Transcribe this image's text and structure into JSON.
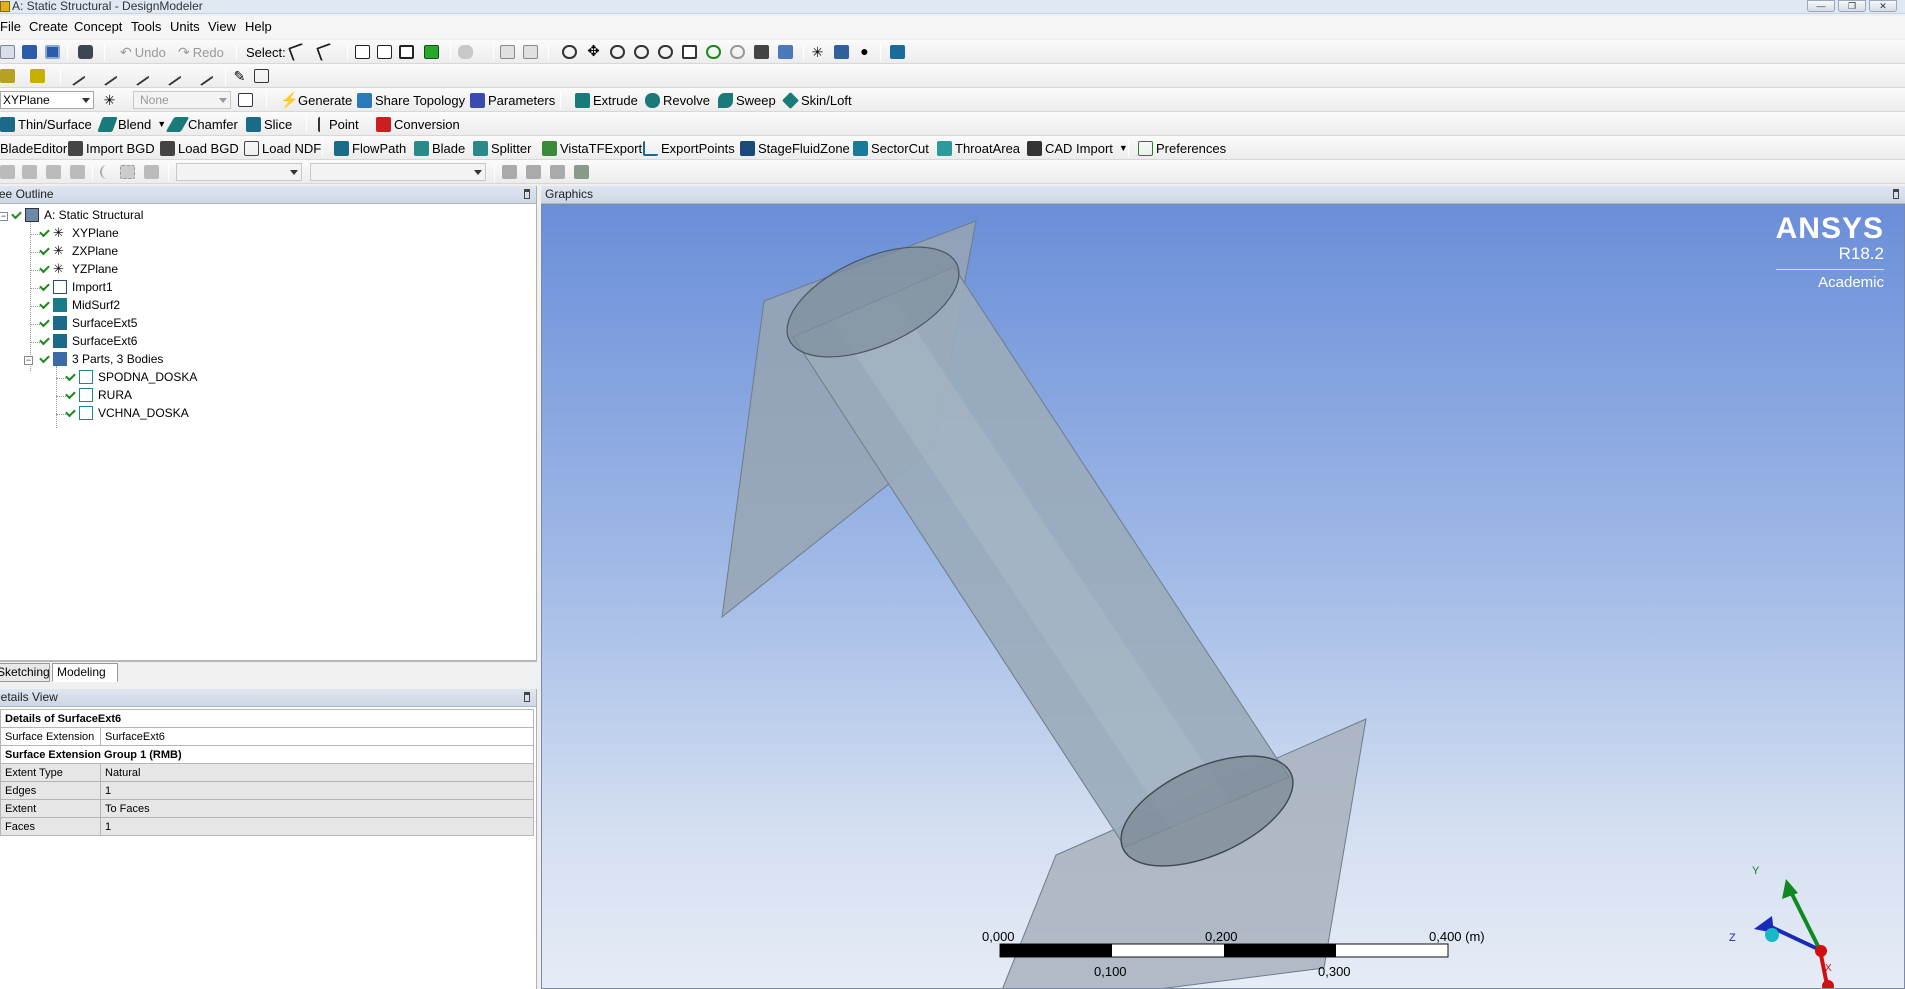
{
  "window": {
    "title": "A: Static Structural - DesignModeler",
    "buttons": [
      "—",
      "❐",
      "✕"
    ]
  },
  "menu": [
    "File",
    "Create",
    "Concept",
    "Tools",
    "Units",
    "View",
    "Help"
  ],
  "toolbar1": {
    "undo": "Undo",
    "redo": "Redo",
    "select": "Select:"
  },
  "toolbar2": {},
  "toolbar3": {
    "plane_combo": "XYPlane",
    "sketch_combo": "None",
    "generate": "Generate",
    "share_topology": "Share Topology",
    "parameters": "Parameters",
    "extrude": "Extrude",
    "revolve": "Revolve",
    "sweep": "Sweep",
    "skin_loft": "Skin/Loft"
  },
  "toolbar4": {
    "thin_surface": "Thin/Surface",
    "blend": "Blend",
    "chamfer": "Chamfer",
    "slice": "Slice",
    "point": "Point",
    "conversion": "Conversion"
  },
  "toolbar5": {
    "blade_editor": "BladeEditor:",
    "import_bgd": "Import BGD",
    "load_bgd": "Load BGD",
    "load_ndf": "Load NDF",
    "flowpath": "FlowPath",
    "blade": "Blade",
    "splitter": "Splitter",
    "vista_tf_export": "VistaTFExport",
    "export_points": "ExportPoints",
    "stage_fluid_zone": "StageFluidZone",
    "sector_cut": "SectorCut",
    "throat_area": "ThroatArea",
    "cad_import": "CAD Import",
    "preferences": "Preferences"
  },
  "tree": {
    "header": "Tree Outline",
    "root": "A: Static Structural",
    "items": [
      "XYPlane",
      "ZXPlane",
      "YZPlane",
      "Import1",
      "MidSurf2",
      "SurfaceExt5",
      "SurfaceExt6",
      "3 Parts, 3 Bodies"
    ],
    "bodies": [
      "SPODNA_DOSKA",
      "RURA",
      "VCHNA_DOSKA"
    ]
  },
  "tabs": [
    "Sketching",
    "Modeling"
  ],
  "details": {
    "header": "Details View",
    "title": "Details of SurfaceExt6",
    "rows": [
      {
        "label": "Surface Extension",
        "value": "SurfaceExt6"
      },
      {
        "group": "Surface Extension Group 1  (RMB)"
      },
      {
        "label": "Extent Type",
        "value": "Natural"
      },
      {
        "label": "Edges",
        "value": "1"
      },
      {
        "label": "Extent",
        "value": "To Faces"
      },
      {
        "label": "Faces",
        "value": "1"
      }
    ]
  },
  "graphics": {
    "header": "Graphics",
    "brand": "ANSYS",
    "version": "R18.2",
    "edition": "Academic",
    "scale": {
      "labels_top": [
        "0,000",
        "0,200",
        "0,400 (m)"
      ],
      "labels_bottom": [
        "0,100",
        "0,300"
      ]
    },
    "axes": {
      "x": "X",
      "y": "Y",
      "z": "Z"
    }
  },
  "colors": {
    "bg_top": "#6a8ed8",
    "bg_bottom": "#e6ecf6",
    "body": "#8fa3b4",
    "check": "#1a8a1a",
    "axis_x": "#d01010",
    "axis_y": "#108a20",
    "axis_z": "#1020c0"
  }
}
